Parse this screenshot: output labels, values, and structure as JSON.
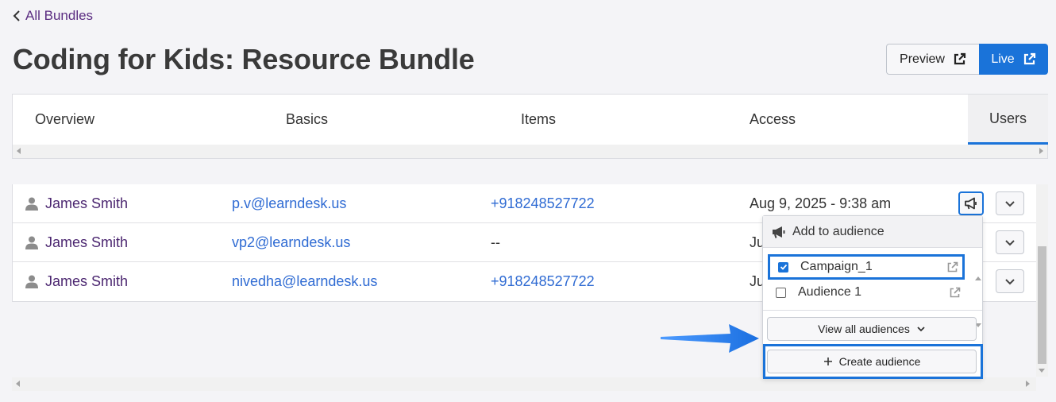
{
  "back_link": {
    "label": "All Bundles"
  },
  "page_title": "Coding for Kids: Resource Bundle",
  "header_buttons": {
    "preview_label": "Preview",
    "live_label": "Live",
    "live_color": "#1a73d9"
  },
  "tabs": [
    {
      "label": "Overview",
      "active": false
    },
    {
      "label": "Basics",
      "active": false
    },
    {
      "label": "Items",
      "active": false
    },
    {
      "label": "Access",
      "active": false
    },
    {
      "label": "Users",
      "active": true
    }
  ],
  "users": [
    {
      "name": "James Smith",
      "email": "p.v@learndesk.us",
      "phone": "+918248527722",
      "date": "Aug 9, 2025 - 9:38 am"
    },
    {
      "name": "James Smith",
      "email": "vp2@learndesk.us",
      "phone": "--",
      "date": "Ju"
    },
    {
      "name": "James Smith",
      "email": "nivedha@learndesk.us",
      "phone": "+918248527722",
      "date": "Ju"
    }
  ],
  "audience_dropdown": {
    "header": "Add to audience",
    "items": [
      {
        "label": "Campaign_1",
        "checked": true
      },
      {
        "label": "Audience 1",
        "checked": false
      }
    ],
    "view_all_label": "View all audiences",
    "create_label": "Create audience"
  },
  "icons": {
    "back": "chevron-left-icon",
    "external": "external-link-icon",
    "user": "user-icon",
    "megaphone": "megaphone-icon",
    "chevron": "chevron-down-icon",
    "plus": "plus-icon"
  },
  "highlight_color": "#1a73d9"
}
